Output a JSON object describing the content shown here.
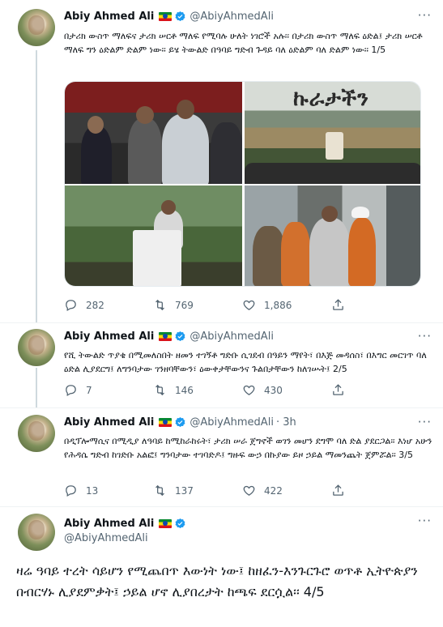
{
  "colors": {
    "text": "#0f1419",
    "muted": "#536471",
    "verified": "#1d9bf0",
    "divider": "#eff3f4"
  },
  "tweets": [
    {
      "name": "Abiy Ahmed Ali",
      "handle": "@AbiyAhmedAli",
      "time": "",
      "text": "በታሪክ ውስጥ ማለፍና ታሪክ ሠርቶ ማለፍ የሚባሉ ሁለት ነገሮች አሉ፡፡ በታሪክ ውስጥ ማለፍ ዕድል፤ ታሪክ ሠርቶ ማለፍ ግን ዕድልም ድልም ነው፡፡ ይሄ ትውልድ በዓባይ ግድብ ጉዳይ ባለ ዕድልም ባለ ድልም ነው፡፡ 1/5",
      "media_text": "ኩራታችን",
      "replies": "282",
      "retweets": "769",
      "likes": "1,886"
    },
    {
      "name": "Abiy Ahmed Ali",
      "handle": "@AbiyAhmedAli",
      "time": "",
      "text": "የሺ ትውልድ ጥያቄ በሚመለስበት ዘመን ተገኝቶ ግድቡ ሲገደብ በዓይን ማየት፣ በእጅ መዳሰስ፣ በእግር መርገጥ ባለ ዕድል ሊያደርግ፤ ለግንባታው ገንዘባቸውን፣ ዕውቀታቸውንና ጉልበታቸውን ከለገሡት፤ 2/5",
      "replies": "7",
      "retweets": "146",
      "likes": "430"
    },
    {
      "name": "Abiy Ahmed Ali",
      "handle": "@AbiyAhmedAli",
      "time": "· 3h",
      "text": "በዲፕሎማሲና በሚዲያ ለዓባይ ከሚከራከሩት፣ ታሪክ ሠራ ጀግኖች ወገን መሆን ደግሞ ባለ ድል ያደርጋል፡፡ እነሆ አሁን የሕዳሴ ግድብ ከገድቡ አልፎ፤ ግንባታው ተገባድዶ፤ ግዙፍ ውኃ በኩያው ይዞ ኃይል ማመንጨት ጀምሯል፡፡ 3/5",
      "replies": "13",
      "retweets": "137",
      "likes": "422"
    },
    {
      "name": "Abiy Ahmed Ali",
      "handle": "@AbiyAhmedAli",
      "text": "ዛሬ ዓባይ ተረት ሳይሆን የሚጨበጥ እውነት ነው፤ ከዘፈን-እንጉርጉሮ ወጥቶ ኢትዮጵያን በብርሃኑ ሊያደምቃት፤ ኃይል ሆኖ ሊያበረታት ከጫፍ ደርሷል፡፡ 4/5"
    }
  ],
  "icons": [
    "reply-icon",
    "retweet-icon",
    "like-icon",
    "share-icon",
    "more-icon",
    "verified-badge-icon",
    "ethiopia-flag-icon"
  ]
}
